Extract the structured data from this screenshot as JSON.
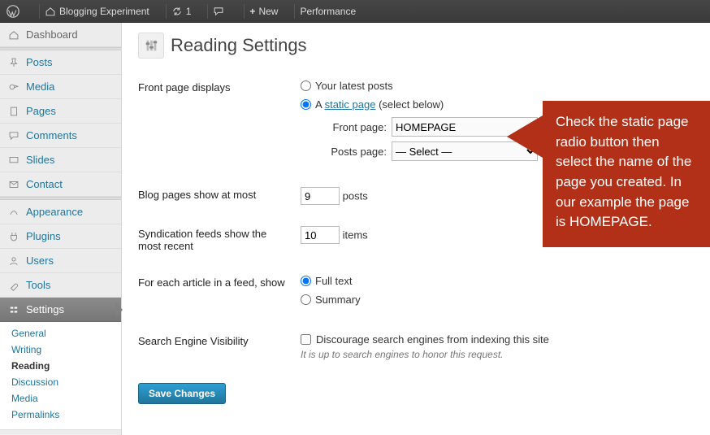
{
  "adminbar": {
    "site_name": "Blogging Experiment",
    "updates_count": "1",
    "new_label": "New",
    "performance_label": "Performance"
  },
  "sidebar": {
    "items": [
      {
        "label": "Dashboard"
      },
      {
        "label": "Posts"
      },
      {
        "label": "Media"
      },
      {
        "label": "Pages"
      },
      {
        "label": "Comments"
      },
      {
        "label": "Slides"
      },
      {
        "label": "Contact"
      },
      {
        "label": "Appearance"
      },
      {
        "label": "Plugins"
      },
      {
        "label": "Users"
      },
      {
        "label": "Tools"
      },
      {
        "label": "Settings"
      }
    ],
    "sub": [
      {
        "label": "General"
      },
      {
        "label": "Writing"
      },
      {
        "label": "Reading"
      },
      {
        "label": "Discussion"
      },
      {
        "label": "Media"
      },
      {
        "label": "Permalinks"
      }
    ]
  },
  "page": {
    "title": "Reading Settings",
    "rows": {
      "front_page_displays": {
        "label": "Front page displays",
        "opt_latest": "Your latest posts",
        "opt_static_prefix": "A ",
        "opt_static_link": "static page",
        "opt_static_suffix": " (select below)",
        "front_page_label": "Front page:",
        "front_page_value": "HOMEPAGE",
        "posts_page_label": "Posts page:",
        "posts_page_value": "— Select —"
      },
      "blog_pages": {
        "label": "Blog pages show at most",
        "value": "9",
        "unit": "posts"
      },
      "syndication": {
        "label": "Syndication feeds show the most recent",
        "value": "10",
        "unit": "items"
      },
      "feed_show": {
        "label": "For each article in a feed, show",
        "opt_full": "Full text",
        "opt_summary": "Summary"
      },
      "sev": {
        "label": "Search Engine Visibility",
        "checkbox_label": "Discourage search engines from indexing this site",
        "desc": "It is up to search engines to honor this request."
      }
    },
    "save_label": "Save Changes"
  },
  "callout": {
    "text": "Check the static page radio button then select the name of the page you created. In our example the page is HOMEPAGE."
  }
}
